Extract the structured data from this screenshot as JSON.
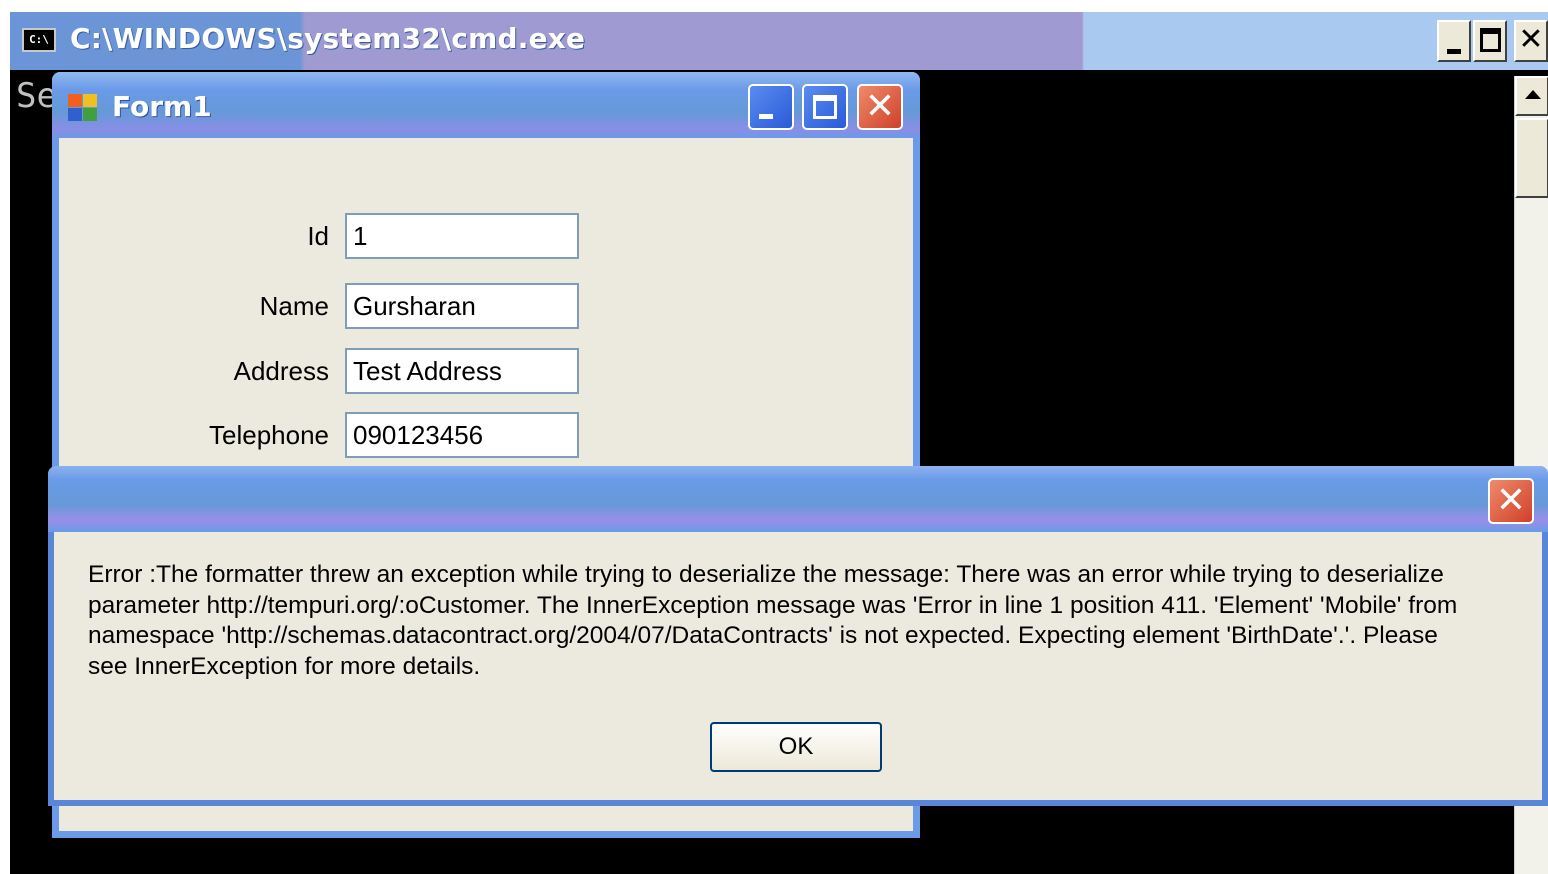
{
  "cmd": {
    "icon_text": "C:\\",
    "title": "C:\\WINDOWS\\system32\\cmd.exe",
    "console_text": "Se",
    "buttons": {
      "minimize": "_",
      "maximize": "□",
      "close": "✕"
    }
  },
  "form1": {
    "title": "Form1",
    "fields": [
      {
        "label": "Id",
        "value": "1"
      },
      {
        "label": "Name",
        "value": "Gursharan"
      },
      {
        "label": "Address",
        "value": "Test Address"
      },
      {
        "label": "Telephone",
        "value": "090123456"
      }
    ],
    "buttons": {
      "close": "✕"
    }
  },
  "dialog": {
    "close": "✕",
    "message_lines": [
      "Error :The formatter threw an exception while trying to deserialize the message: There was an error while trying to deserialize",
      "parameter http://tempuri.org/:oCustomer. The InnerException message was 'Error in line 1 position 411. 'Element' 'Mobile' from",
      "namespace 'http://schemas.datacontract.org/2004/07/DataContracts' is not expected. Expecting element 'BirthDate'.'.  Please",
      "see InnerException for more details."
    ],
    "ok_label": "OK"
  }
}
